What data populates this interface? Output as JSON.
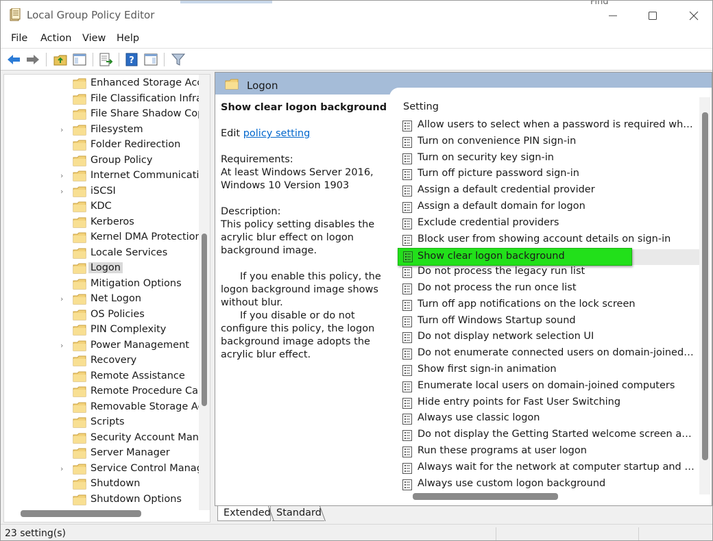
{
  "window": {
    "title": "Local Group Policy Editor",
    "background_tab_text": "Find"
  },
  "menu": [
    "File",
    "Action",
    "View",
    "Help"
  ],
  "toolbar": {
    "buttons": [
      "back-icon",
      "forward-icon",
      "up-folder-icon",
      "show-hide-tree-icon",
      "export-list-icon",
      "help-icon",
      "properties-icon",
      "filter-icon"
    ]
  },
  "tree": {
    "items": [
      {
        "label": "Enhanced Storage Acces",
        "expandable": false
      },
      {
        "label": "File Classification Infrast",
        "expandable": false
      },
      {
        "label": "File Share Shadow Copy",
        "expandable": false
      },
      {
        "label": "Filesystem",
        "expandable": true
      },
      {
        "label": "Folder Redirection",
        "expandable": false
      },
      {
        "label": "Group Policy",
        "expandable": false
      },
      {
        "label": "Internet Communication",
        "expandable": true
      },
      {
        "label": "iSCSI",
        "expandable": true
      },
      {
        "label": "KDC",
        "expandable": false
      },
      {
        "label": "Kerberos",
        "expandable": false
      },
      {
        "label": "Kernel DMA Protection",
        "expandable": false
      },
      {
        "label": "Locale Services",
        "expandable": false
      },
      {
        "label": "Logon",
        "expandable": false,
        "selected": true
      },
      {
        "label": "Mitigation Options",
        "expandable": false
      },
      {
        "label": "Net Logon",
        "expandable": true
      },
      {
        "label": "OS Policies",
        "expandable": false
      },
      {
        "label": "PIN Complexity",
        "expandable": false
      },
      {
        "label": "Power Management",
        "expandable": true
      },
      {
        "label": "Recovery",
        "expandable": false
      },
      {
        "label": "Remote Assistance",
        "expandable": false
      },
      {
        "label": "Remote Procedure Call",
        "expandable": false
      },
      {
        "label": "Removable Storage Acce",
        "expandable": false
      },
      {
        "label": "Scripts",
        "expandable": false
      },
      {
        "label": "Security Account Manag",
        "expandable": false
      },
      {
        "label": "Server Manager",
        "expandable": false
      },
      {
        "label": "Service Control Manage",
        "expandable": true
      },
      {
        "label": "Shutdown",
        "expandable": false
      },
      {
        "label": "Shutdown Options",
        "expandable": false
      }
    ]
  },
  "right_pane": {
    "header_title": "Logon",
    "description": {
      "heading": "Show clear logon background",
      "edit_prefix": "Edit ",
      "edit_link": "policy setting ",
      "requirements_label": "Requirements:",
      "requirements_text": "At least Windows Server 2016, Windows 10 Version 1903",
      "description_label": "Description:",
      "description_text": "This policy setting disables the acrylic blur effect on logon background image.",
      "enable_text": "If you enable this policy, the logon background image shows without blur.",
      "disable_text": "If you disable or do not configure this policy, the logon background image adopts the acrylic blur effect."
    },
    "column_header": "Setting",
    "settings": [
      "Allow users to select when a password is required when resuming from connected standby",
      "Turn on convenience PIN sign-in",
      "Turn on security key sign-in",
      "Turn off picture password sign-in",
      "Assign a default credential provider",
      "Assign a default domain for logon",
      "Exclude credential providers",
      "Block user from showing account details on sign-in",
      "Show clear logon background",
      "Do not process the legacy run list",
      "Do not process the run once list",
      "Turn off app notifications on the lock screen",
      "Turn off Windows Startup sound",
      "Do not display network selection UI",
      "Do not enumerate connected users on domain-joined computers",
      "Show first sign-in animation",
      "Enumerate local users on domain-joined computers",
      "Hide entry points for Fast User Switching",
      "Always use classic logon",
      "Do not display the Getting Started welcome screen at logon",
      "Run these programs at user logon",
      "Always wait for the network at computer startup and logon",
      "Always use custom logon background"
    ],
    "selected_setting": "Show clear logon background",
    "highlight_color": "#22e01a"
  },
  "tabs": [
    "Extended",
    "Standard"
  ],
  "status": {
    "text": "23 setting(s)"
  }
}
